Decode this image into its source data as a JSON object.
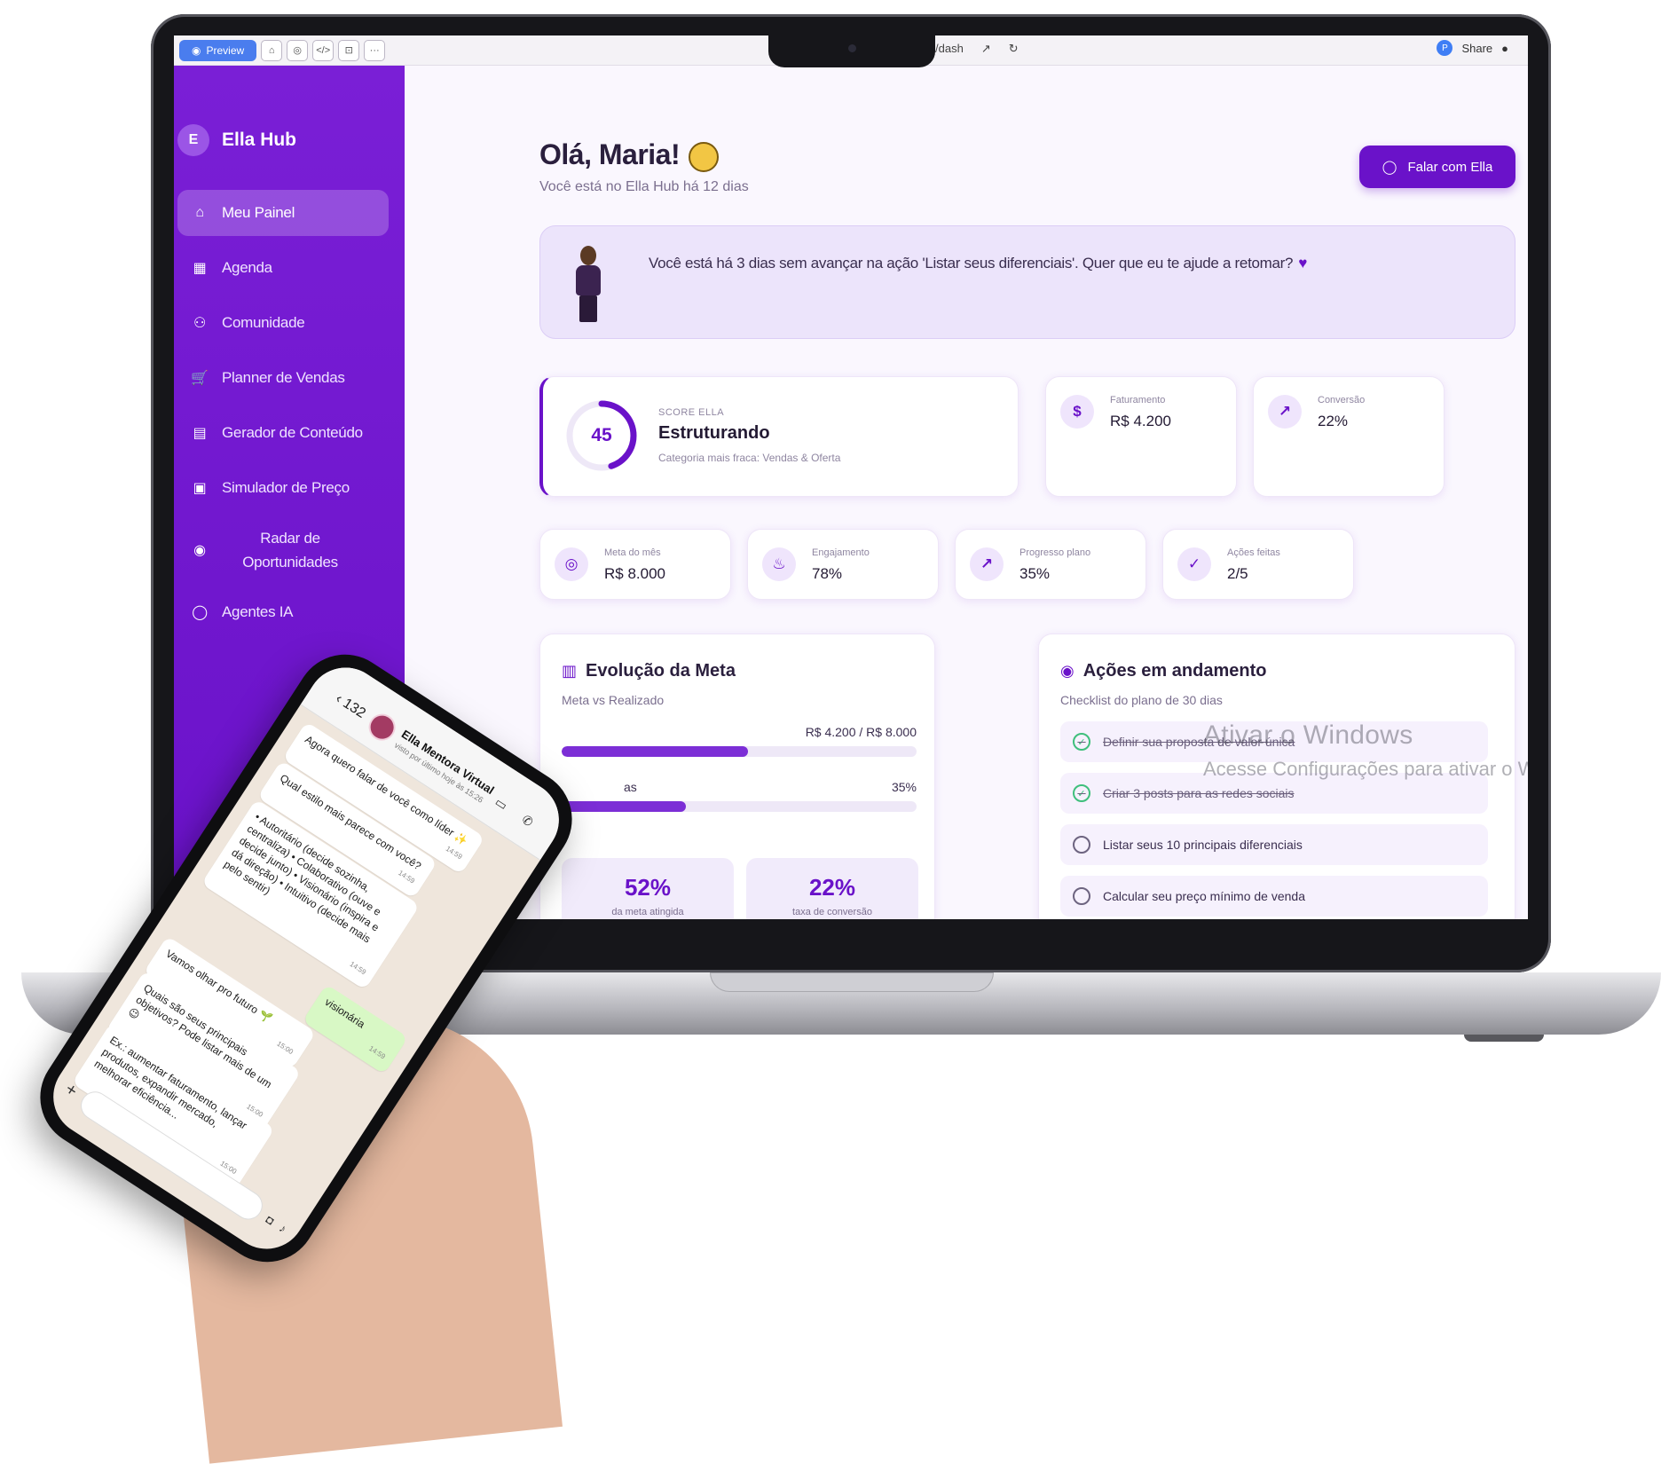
{
  "topbar": {
    "preview_label": "Preview",
    "tools": [
      "⌂",
      "◎",
      "</>",
      "⊡",
      "···"
    ],
    "url_fragment": "/dash",
    "share_label": "Share"
  },
  "sidebar": {
    "brand_initial": "E",
    "brand_name": "Ella Hub",
    "items": [
      {
        "label": "Meu Painel",
        "icon": "⌂",
        "active": true
      },
      {
        "label": "Agenda",
        "icon": "▦"
      },
      {
        "label": "Comunidade",
        "icon": "⚇"
      },
      {
        "label": "Planner de Vendas",
        "icon": "🛒"
      },
      {
        "label": "Gerador de Conteúdo",
        "icon": "▤"
      },
      {
        "label": "Simulador de Preço",
        "icon": "▣"
      },
      {
        "label": "Radar de Oportunidades",
        "icon": "◉"
      },
      {
        "label": "Agentes IA",
        "icon": "◯"
      }
    ]
  },
  "header": {
    "greeting": "Olá, Maria!",
    "subtitle": "Você está no Ella Hub há 12 dias",
    "cta_label": "Falar com Ella"
  },
  "banner": {
    "message": "Você está há 3 dias sem avançar na ação 'Listar seus diferenciais'. Quer que eu te ajude a retomar?"
  },
  "score": {
    "value": "45",
    "fraction": 0.45,
    "label": "SCORE ELLA",
    "title": "Estruturando",
    "subtitle": "Categoria mais fraca: Vendas & Oferta"
  },
  "stats_top": [
    {
      "icon": "$",
      "label": "Faturamento",
      "value": "R$ 4.200"
    },
    {
      "icon": "↗",
      "label": "Conversão",
      "value": "22%"
    }
  ],
  "stats_row": [
    {
      "icon": "◎",
      "label": "Meta do mês",
      "value": "R$ 8.000"
    },
    {
      "icon": "♨",
      "label": "Engajamento",
      "value": "78%"
    },
    {
      "icon": "↗",
      "label": "Progresso plano",
      "value": "35%"
    },
    {
      "icon": "✓",
      "label": "Ações feitas",
      "value": "2/5"
    }
  ],
  "evolucao": {
    "title": "Evolução da Meta",
    "subtitle": "Meta vs Realizado",
    "bar1_value_label": "R$ 4.200 / R$ 8.000",
    "bar1_fraction": 0.525,
    "bar2_label": "as",
    "bar2_value_label": "35%",
    "bar2_fraction": 0.35,
    "kpis": [
      {
        "value": "52%",
        "label": "da meta atingida"
      },
      {
        "value": "22%",
        "label": "taxa de conversão"
      }
    ]
  },
  "acoes": {
    "title": "Ações em andamento",
    "subtitle": "Checklist do plano de 30 dias",
    "tasks": [
      {
        "label": "Definir sua proposta de valor única",
        "done": true
      },
      {
        "label": "Criar 3 posts para as redes sociais",
        "done": true
      },
      {
        "label": "Listar seus 10 principais diferenciais",
        "done": false
      },
      {
        "label": "Calcular seu preço mínimo de venda",
        "done": false
      }
    ]
  },
  "watermark": {
    "line1": "Ativar o Windows",
    "line2": "Acesse Configurações para ativar o W"
  },
  "phone": {
    "back_count": "132",
    "contact_name": "Ella Mentora Virtual",
    "contact_status": "visto por último hoje às 15:26",
    "messages": [
      {
        "text": "Agora quero falar de você como líder ✨",
        "time": "14:59",
        "out": false
      },
      {
        "text": "Qual estilo mais parece com você?",
        "time": "14:59",
        "out": false
      },
      {
        "text": "• Autoritário (decide sozinha, centraliza) • Colaborativo (ouve e decide junto) • Visionário (inspira e dá direção) • Intuitivo (decide mais pelo sentir)",
        "time": "14:59",
        "out": false
      },
      {
        "text": "visionária",
        "time": "14:59",
        "out": true
      },
      {
        "text": "Vamos olhar pro futuro 🌱",
        "time": "15:00",
        "out": false
      },
      {
        "text": "Quais são seus principais objetivos? Pode listar mais de um 😉",
        "time": "15:00",
        "out": false
      },
      {
        "text": "Ex.: aumentar faturamento, lançar produtos, expandir mercado, melhorar eficiência...",
        "time": "15:00",
        "out": false
      }
    ]
  },
  "colors": {
    "primary": "#6a12c9",
    "sidebar": "#7a1fd6",
    "success": "#3fbf7c"
  }
}
